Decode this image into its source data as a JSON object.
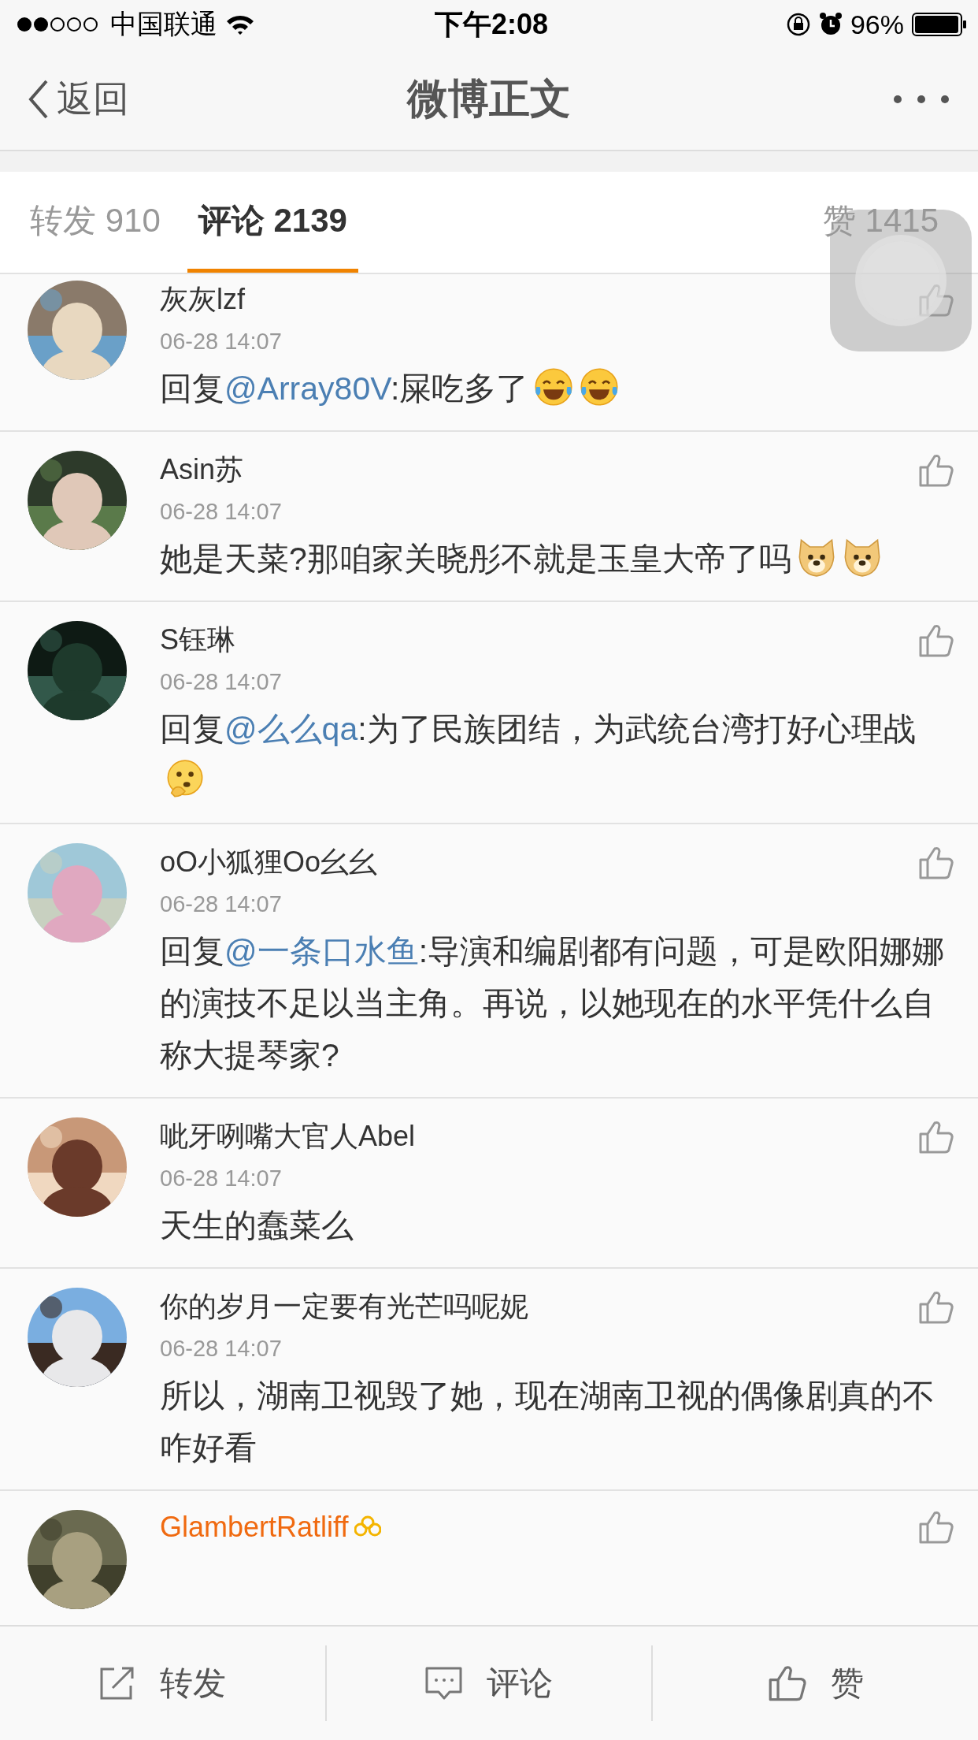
{
  "status_bar": {
    "carrier": "中国联通",
    "time": "下午2:08",
    "battery": "96%"
  },
  "nav": {
    "back": "返回",
    "title": "微博正文"
  },
  "tabs": [
    {
      "label": "转发 910",
      "selected": false
    },
    {
      "label": "评论 2139",
      "selected": true
    },
    {
      "label": "赞 1415",
      "selected": false
    }
  ],
  "comments": [
    {
      "name": "灰灰lzf",
      "vip": false,
      "time": "06-28 14:07",
      "prefix": "回复",
      "mention": "@Array80V",
      "text": ":屎吃多了",
      "emoji": [
        {
          "kind": "laugh"
        },
        {
          "kind": "laugh"
        }
      ]
    },
    {
      "name": "Asin苏",
      "vip": false,
      "time": "06-28 14:07",
      "text": "她是天菜?那咱家关晓彤不就是玉皇大帝了吗",
      "emoji": [
        {
          "kind": "doge"
        },
        {
          "kind": "doge"
        }
      ]
    },
    {
      "name": "S钰琳",
      "vip": false,
      "time": "06-28 14:07",
      "prefix": "回复",
      "mention": "@么么qa",
      "text": ":为了民族团结，为武统台湾打好心理战",
      "emoji": [
        {
          "kind": "think"
        }
      ]
    },
    {
      "name": "oO小狐狸Oo幺幺",
      "vip": false,
      "time": "06-28 14:07",
      "prefix": "回复",
      "mention": "@一条口水鱼",
      "text": ":导演和编剧都有问题，可是欧阳娜娜的演技不足以当主角。再说，以她现在的水平凭什么自称大提琴家?"
    },
    {
      "name": "呲牙咧嘴大官人Abel",
      "vip": false,
      "time": "06-28 14:07",
      "text": "天生的蠢菜么"
    },
    {
      "name": "你的岁月一定要有光芒吗呢妮",
      "vip": false,
      "time": "06-28 14:07",
      "text": "所以，湖南卫视毁了她，现在湖南卫视的偶像剧真的不咋好看"
    },
    {
      "name": "GlambertRatliff",
      "vip": true
    }
  ],
  "bottom_bar": [
    {
      "kind": "repost",
      "label": "转发"
    },
    {
      "kind": "comment",
      "label": "评论"
    },
    {
      "kind": "like",
      "label": "赞"
    }
  ]
}
